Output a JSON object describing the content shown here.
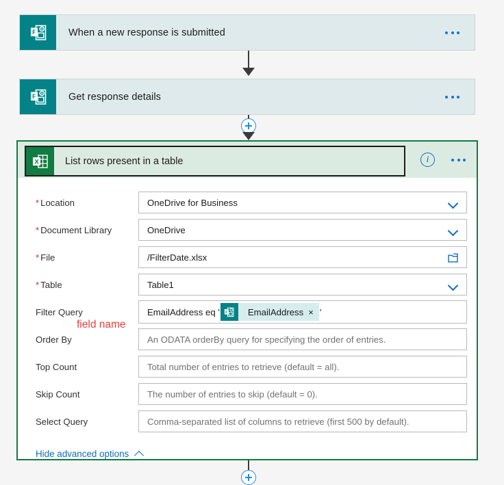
{
  "flow": {
    "trigger": {
      "title": "When a new response is submitted",
      "icon": "microsoft-forms-icon",
      "menu_icon": "ellipsis-icon"
    },
    "action_get_response": {
      "title": "Get response details",
      "icon": "microsoft-forms-icon",
      "menu_icon": "ellipsis-icon"
    },
    "action_list_rows": {
      "title": "List rows present in a table",
      "icon": "excel-icon",
      "info_icon": "info-icon",
      "info_glyph": "i",
      "menu_icon": "ellipsis-icon",
      "selected": true,
      "fields": [
        {
          "label": "Location",
          "required": true,
          "value": "OneDrive for Business",
          "placeholder": "",
          "control": "dropdown",
          "trailing_icon": "chevron-down-icon",
          "name": "location"
        },
        {
          "label": "Document Library",
          "required": true,
          "value": "OneDrive",
          "placeholder": "",
          "control": "dropdown",
          "trailing_icon": "chevron-down-icon",
          "name": "document-library"
        },
        {
          "label": "File",
          "required": true,
          "value": "/FilterDate.xlsx",
          "placeholder": "",
          "control": "file-picker",
          "trailing_icon": "folder-icon",
          "name": "file"
        },
        {
          "label": "Table",
          "required": true,
          "value": "Table1",
          "placeholder": "",
          "control": "dropdown",
          "trailing_icon": "chevron-down-icon",
          "name": "table"
        },
        {
          "label": "Filter Query",
          "required": false,
          "value": "",
          "placeholder": "",
          "control": "token-input",
          "trailing_icon": "",
          "name": "filter-query"
        },
        {
          "label": "Order By",
          "required": false,
          "value": "",
          "placeholder": "An ODATA orderBy query for specifying the order of entries.",
          "control": "text",
          "trailing_icon": "",
          "name": "order-by"
        },
        {
          "label": "Top Count",
          "required": false,
          "value": "",
          "placeholder": "Total number of entries to retrieve (default = all).",
          "control": "text",
          "trailing_icon": "",
          "name": "top-count"
        },
        {
          "label": "Skip Count",
          "required": false,
          "value": "",
          "placeholder": "The number of entries to skip (default = 0).",
          "control": "text",
          "trailing_icon": "",
          "name": "skip-count"
        },
        {
          "label": "Select Query",
          "required": false,
          "value": "",
          "placeholder": "Comma-separated list of columns to retrieve (first 500 by default).",
          "control": "text",
          "trailing_icon": "",
          "name": "select-query"
        }
      ],
      "filter_query": {
        "prefix": "EmailAddress eq '",
        "token_label": "EmailAddress",
        "token_icon": "microsoft-forms-icon",
        "token_remove_glyph": "×",
        "suffix": "'"
      },
      "advanced_toggle": {
        "label": "Hide advanced options",
        "icon": "chevron-up-icon"
      }
    },
    "add_step_buttons": [
      {
        "name": "add-step-between-response-and-excel",
        "icon": "plus-circle-icon"
      },
      {
        "name": "add-step-after-excel",
        "icon": "plus-circle-icon"
      }
    ]
  },
  "annotations": [
    {
      "text": "field name",
      "color": "#ef3b3b",
      "name": "annotation-field-name"
    }
  ],
  "colors": {
    "forms_teal": "#038387",
    "excel_green": "#107c41",
    "trigger_card_bg": "#dfeaec",
    "excel_card_header_bg": "#dcebe1",
    "accent_blue": "#0f6cbd",
    "annotation_red": "#ef3b3b",
    "canvas_bg": "#f5f5f5"
  }
}
